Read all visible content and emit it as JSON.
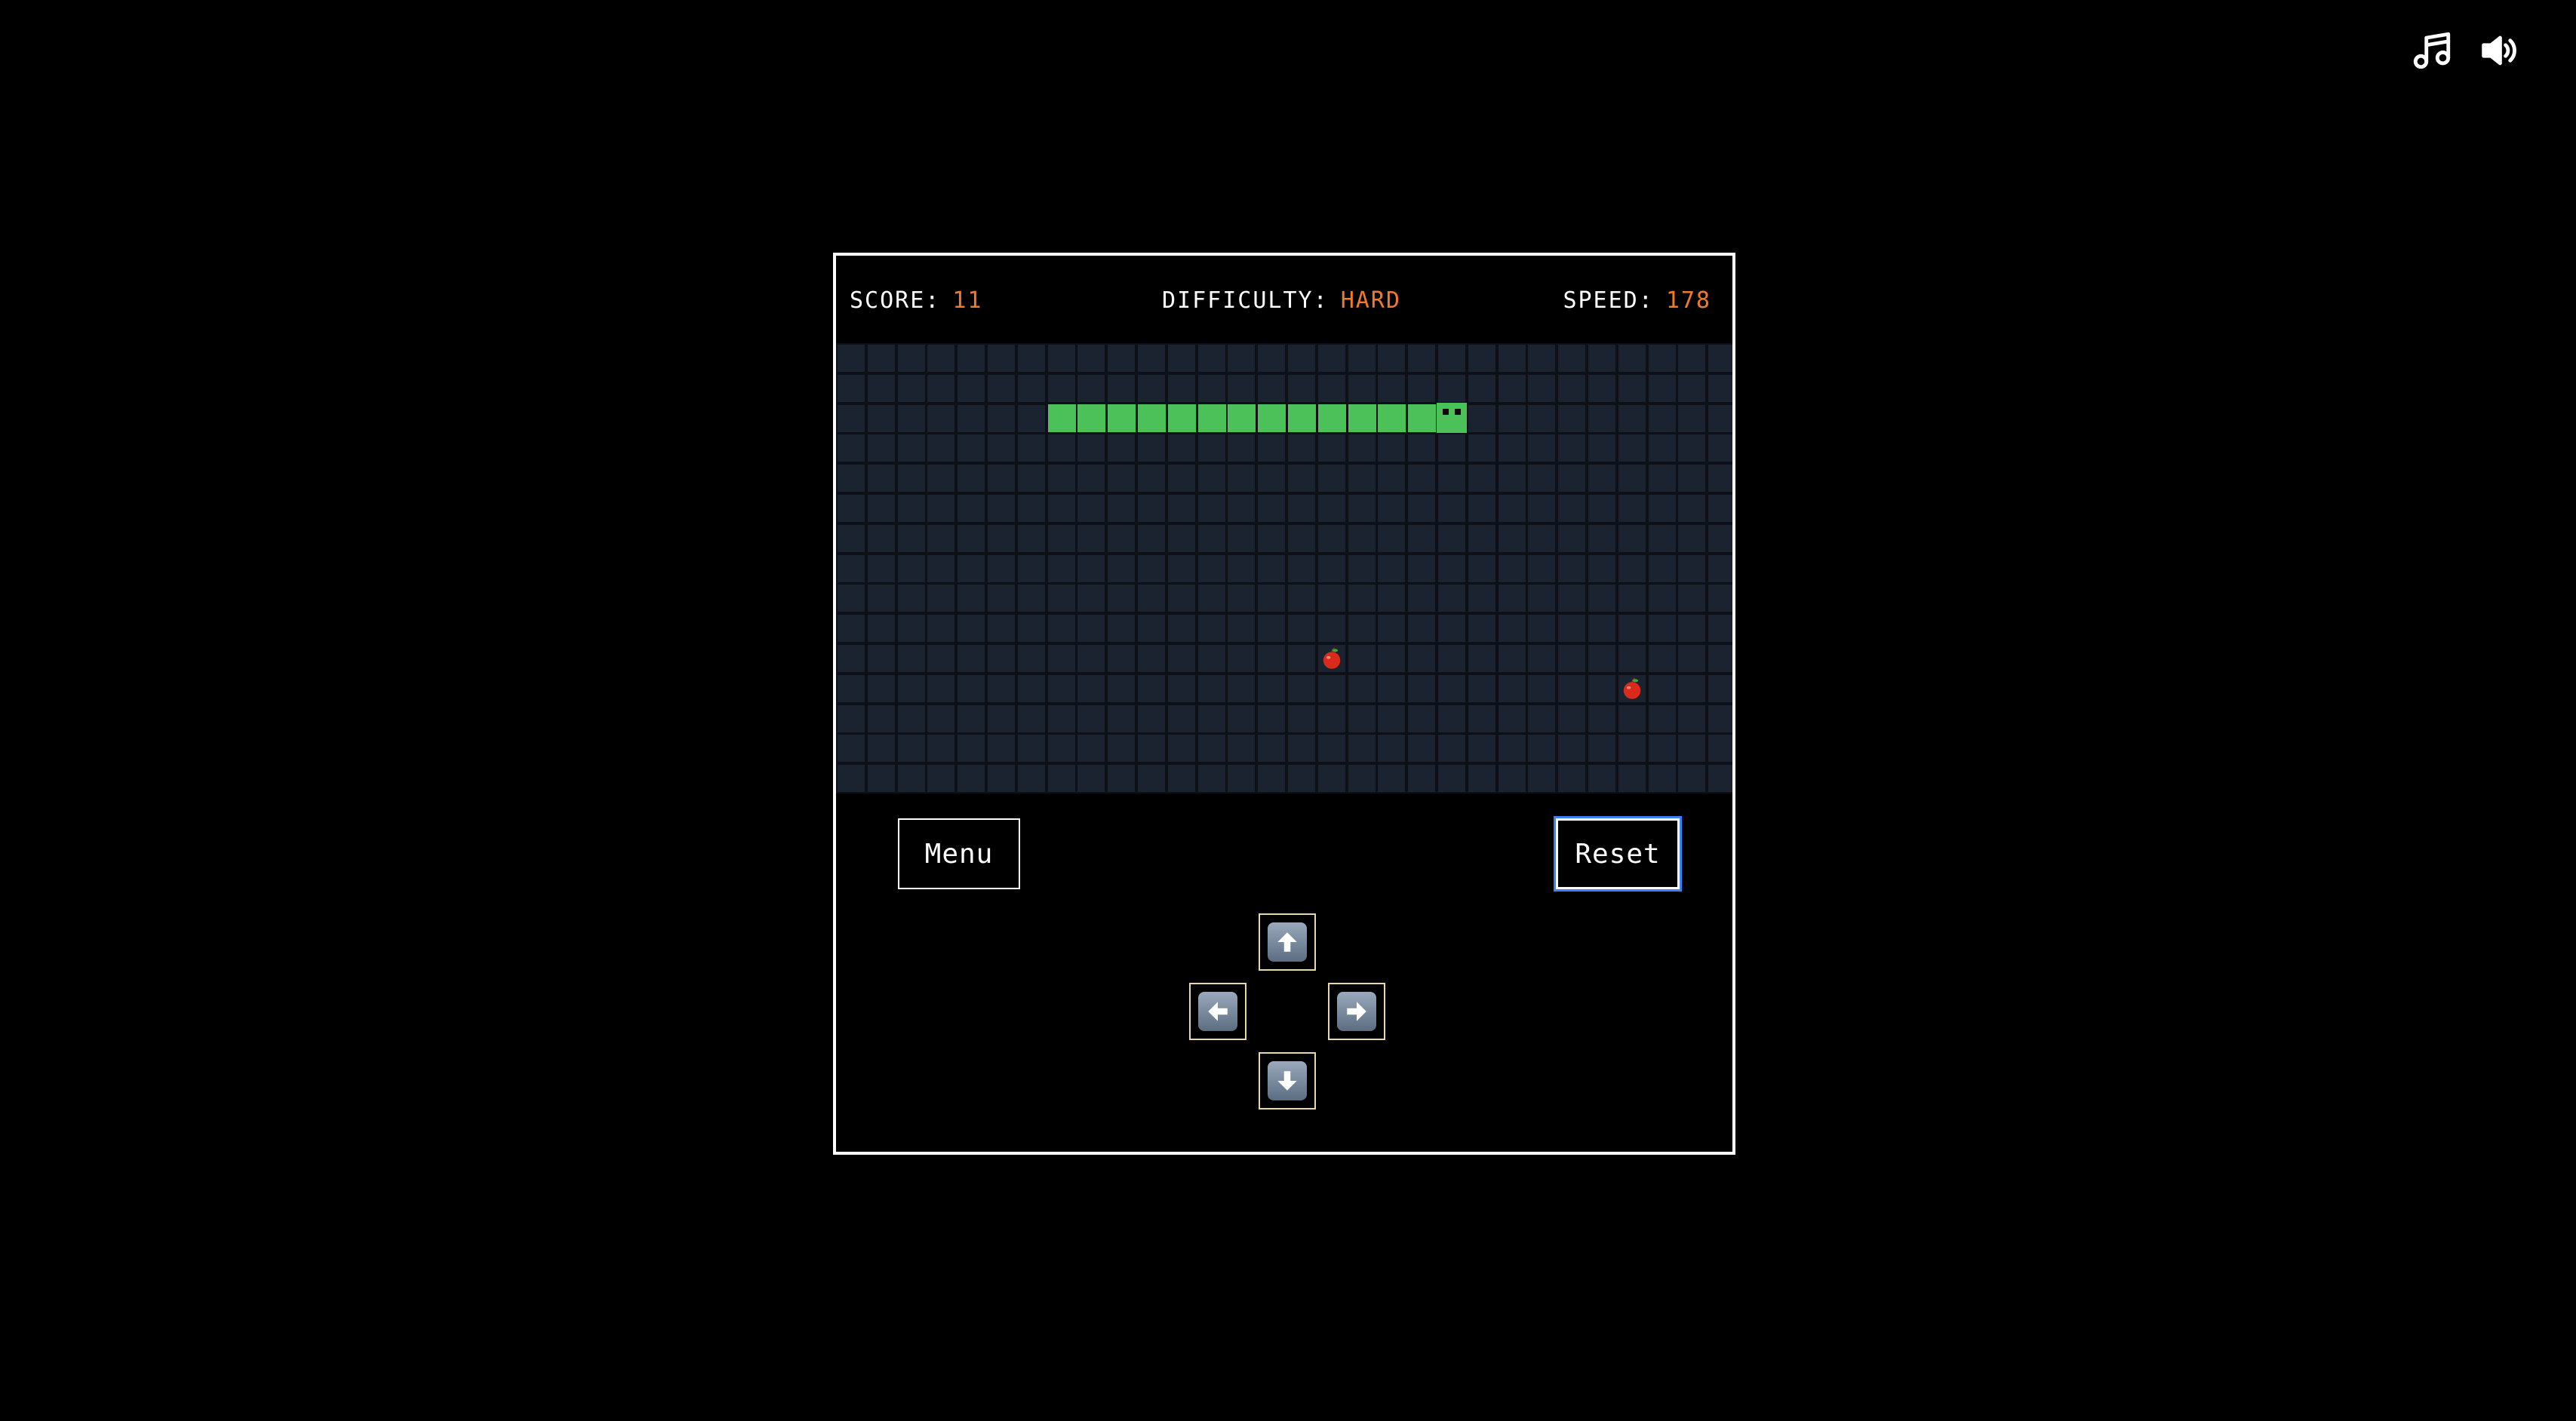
{
  "top_controls": {
    "music_icon": "music-note-icon",
    "volume_icon": "speaker-volume-icon"
  },
  "hud": {
    "score_label": "SCORE:",
    "score_value": "11",
    "difficulty_label": "DIFFICULTY:",
    "difficulty_value": "HARD",
    "speed_label": "SPEED:",
    "speed_value": "178"
  },
  "board": {
    "columns": 30,
    "rows": 15,
    "snake_length": 14,
    "snake_direction": "right",
    "apple_count": 2
  },
  "buttons": {
    "menu_label": "Menu",
    "reset_label": "Reset"
  },
  "dpad": {
    "up_icon": "arrow-up-icon",
    "left_icon": "arrow-left-icon",
    "right_icon": "arrow-right-icon",
    "down_icon": "arrow-down-icon"
  },
  "colors": {
    "background": "#000000",
    "board": "#0d1117",
    "cell": "#1b2230",
    "snake": "#4cc15a",
    "accent_value": "#f07a2c",
    "apple": "#d92a1c",
    "focus_outline": "#3b82f6"
  }
}
